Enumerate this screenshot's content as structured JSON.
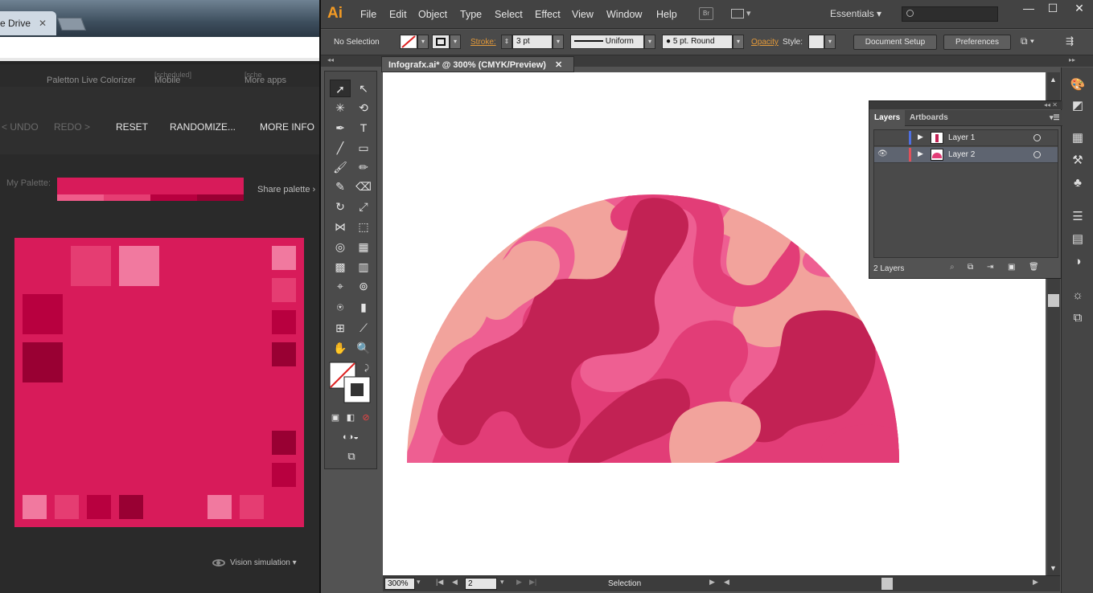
{
  "browser": {
    "tab_label": "e Drive",
    "tab_close": "✕",
    "top_links": [
      {
        "label": "Paletton Live Colorizer",
        "tag": ""
      },
      {
        "label": "Mobile",
        "tag": "[scheduled]"
      },
      {
        "label": "More apps",
        "tag": "[sche"
      }
    ],
    "nav": {
      "undo": "< UNDO",
      "redo": "REDO >",
      "reset": "RESET",
      "randomize": "RANDOMIZE...",
      "more_info": "MORE INFO"
    },
    "palette_label": "My Palette:",
    "share": "Share palette",
    "share_arrow": "›",
    "vision": "Vision simulation",
    "vision_arrow": "▾",
    "colors": {
      "base": "#d81b5a",
      "light1": "#ef5c8a",
      "light2": "#f1799f",
      "mid": "#e53d72",
      "dark1": "#b8003f",
      "dark2": "#990033"
    }
  },
  "illustrator": {
    "logo": "Ai",
    "menu": [
      "File",
      "Edit",
      "Object",
      "Type",
      "Select",
      "Effect",
      "View",
      "Window",
      "Help"
    ],
    "bridge": "Br",
    "workspace": "Essentials",
    "workspace_arrow": "▾",
    "window_buttons": {
      "minimize": "—",
      "maximize": "☐",
      "close": "✕"
    },
    "control": {
      "selection": "No Selection",
      "stroke_label": "Stroke:",
      "stroke_value": "3 pt",
      "profile": "Uniform",
      "brush": "5 pt. Round",
      "opacity_label": "Opacity",
      "style_label": "Style:",
      "doc_setup": "Document Setup",
      "preferences": "Preferences"
    },
    "document_tab": "Infografx.ai* @ 300% (CMYK/Preview)",
    "doc_tab_close": "✕",
    "status": {
      "zoom": "300%",
      "artboard": "2",
      "tool": "Selection"
    },
    "layers_panel": {
      "tabs": [
        "Layers",
        "Artboards"
      ],
      "layers": [
        {
          "name": "Layer 1",
          "color": "#4f6fe0",
          "visible": false
        },
        {
          "name": "Layer 2",
          "color": "#e0505a",
          "visible": true
        }
      ],
      "count": "2 Layers"
    },
    "art_colors": {
      "light": "#f2a39c",
      "pink": "#ee5f92",
      "mid": "#e23d77",
      "dark": "#c22254"
    }
  }
}
